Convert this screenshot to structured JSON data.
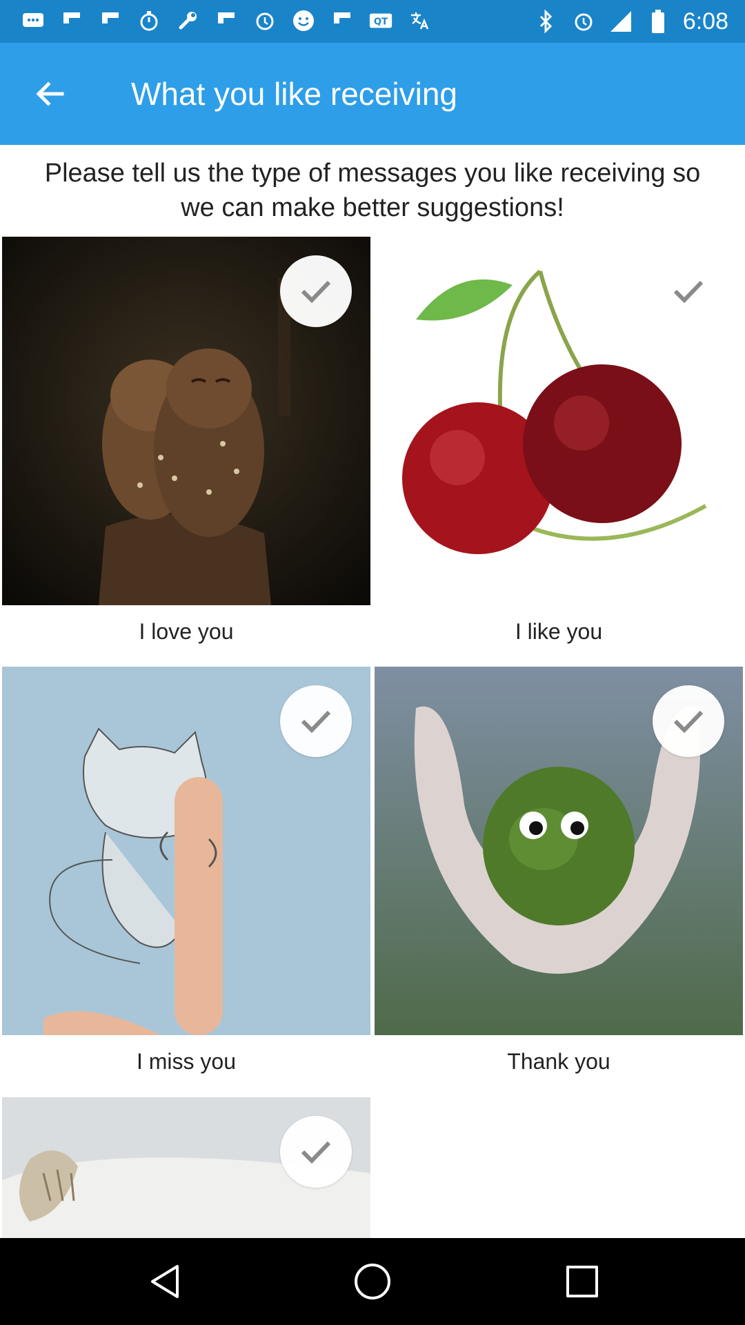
{
  "status_bar": {
    "time": "6:08",
    "icons": [
      "messaging-icon",
      "flipboard-icon",
      "flipboard-icon",
      "stopwatch-icon",
      "wrench-icon",
      "flipboard-icon",
      "alarm-icon",
      "smiley-icon",
      "flipboard-icon",
      "qt-icon",
      "translate-icon",
      "bluetooth-icon",
      "alarm-icon",
      "signal-icon",
      "battery-icon"
    ]
  },
  "app_bar": {
    "title": "What you like receiving",
    "back_icon": "arrow-left-icon"
  },
  "intro_text": "Please tell us the type of messages you like receiving so we can make better suggestions!",
  "items": [
    {
      "label": "I love you",
      "image": "two-owls-cuddling",
      "checked": true
    },
    {
      "label": "I like you",
      "image": "pair-of-cherries",
      "checked": false
    },
    {
      "label": "I miss you",
      "image": "sketched-cat-hugging-finger",
      "checked": true
    },
    {
      "label": "Thank you",
      "image": "moss-creature-in-hands",
      "checked": true
    },
    {
      "label": "",
      "image": "sleeping-white-seal-pup",
      "checked": true
    }
  ],
  "nav_bar": {
    "back": "triangle-back-icon",
    "home": "circle-home-icon",
    "recents": "square-recents-icon"
  },
  "colors": {
    "status_bar": "#1a84c9",
    "app_bar": "#2e9ee8",
    "nav_bar": "#000000"
  }
}
